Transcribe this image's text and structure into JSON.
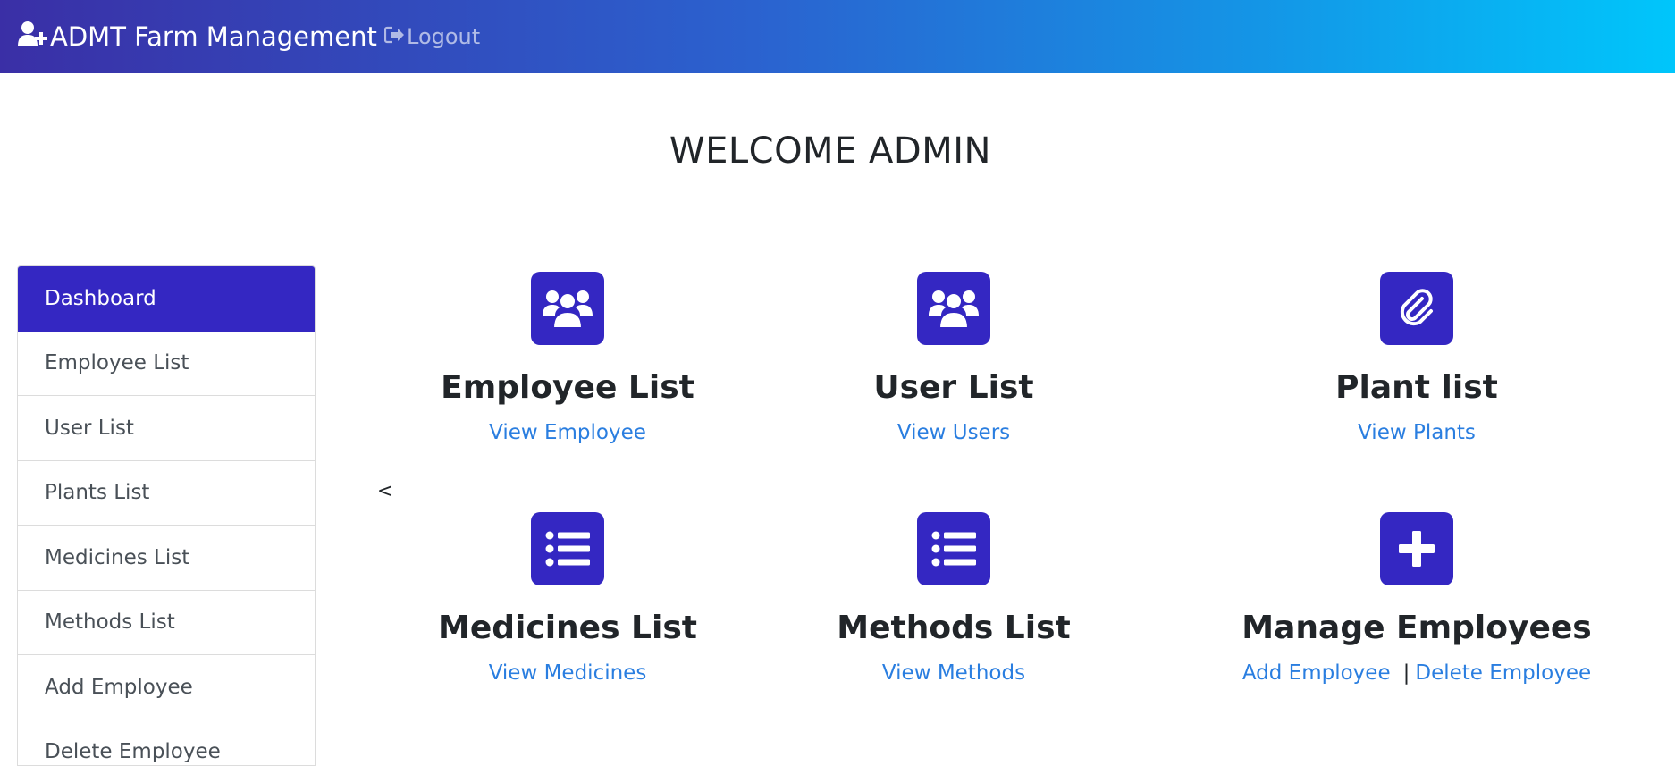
{
  "navbar": {
    "brand": "ADMT Farm Management",
    "brand_icon": "user-plus-icon",
    "logout_label": "Logout",
    "logout_icon": "sign-out-icon",
    "gradient_colors": [
      "#3a2fa6",
      "#00c6fb"
    ]
  },
  "welcome": "WELCOME ADMIN",
  "sidebar": {
    "items": [
      {
        "label": "Dashboard",
        "active": true
      },
      {
        "label": "Employee List"
      },
      {
        "label": "User List"
      },
      {
        "label": "Plants List"
      },
      {
        "label": "Medicines List"
      },
      {
        "label": "Methods List"
      },
      {
        "label": "Add Employee"
      },
      {
        "label": "Delete Employee"
      }
    ],
    "active_color": "#3427c2"
  },
  "stray_text": "<",
  "cards": [
    {
      "title": "Employee List",
      "icon": "users-icon",
      "links": [
        "View Employee"
      ]
    },
    {
      "title": "User List",
      "icon": "users-icon",
      "links": [
        "View Users"
      ]
    },
    {
      "title": "Plant list",
      "icon": "paperclip-icon",
      "links": [
        "View Plants"
      ]
    },
    {
      "title": "Medicines List",
      "icon": "list-icon",
      "links": [
        "View Medicines"
      ]
    },
    {
      "title": "Methods List",
      "icon": "list-icon",
      "links": [
        "View Methods"
      ]
    },
    {
      "title": "Manage Employees",
      "icon": "plus-icon",
      "links": [
        "Add Employee",
        "Delete Employee"
      ],
      "separator": "|"
    }
  ],
  "colors": {
    "icon_bg": "#3427c2",
    "link": "#2a7ee0"
  }
}
